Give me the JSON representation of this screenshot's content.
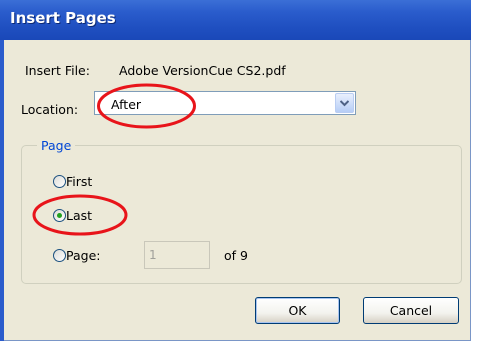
{
  "dialog": {
    "title": "Insert Pages",
    "insert_file_label": "Insert File:",
    "insert_file_value": "Adobe VersionCue CS2.pdf",
    "location_label": "Location:",
    "location_value": "After",
    "page_group_label": "Page",
    "options": [
      {
        "label": "First",
        "selected": false
      },
      {
        "label": "Last",
        "selected": true
      },
      {
        "label": "Page:",
        "selected": false
      }
    ],
    "page_number_value": "1",
    "of_total": "of 9",
    "ok_label": "OK",
    "cancel_label": "Cancel"
  },
  "colors": {
    "title_bar": "#2a5ccc",
    "dialog_bg": "#ece9d8",
    "group_label": "#0046d5",
    "annotation": "#e8141a"
  },
  "icons": {
    "dropdown": "chevron-down-icon"
  }
}
